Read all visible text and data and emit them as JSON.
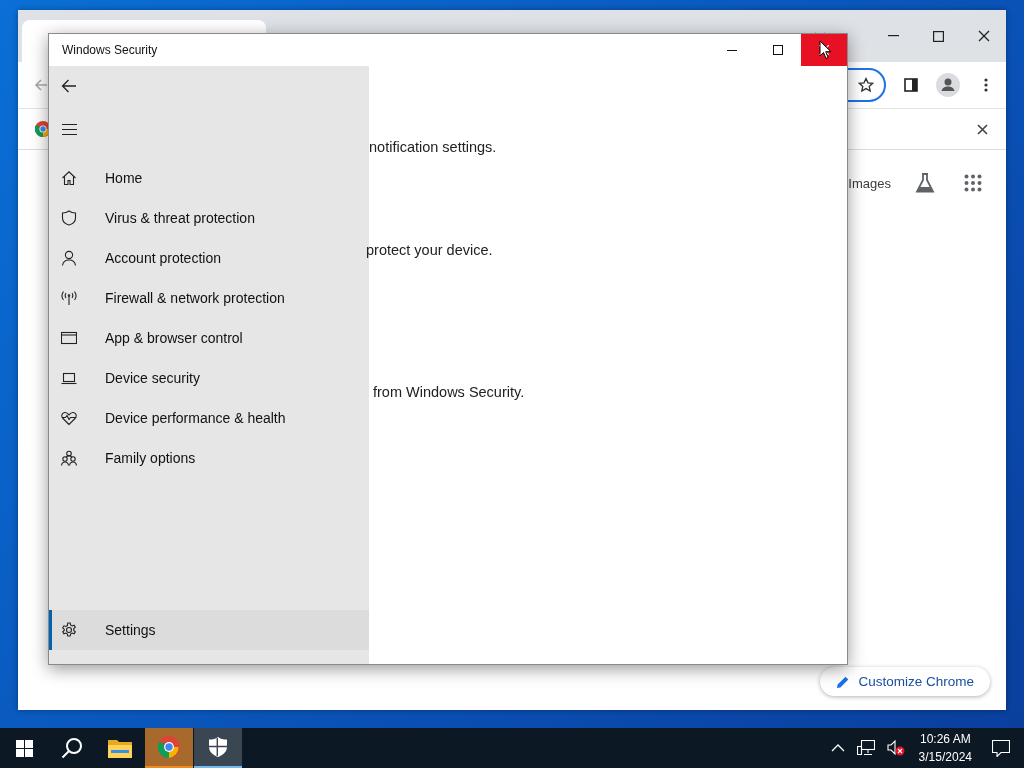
{
  "browser": {
    "toolbar": {
      "omnibox_focused": true
    },
    "results_header": {
      "images_link": "Images"
    },
    "customize_button": "Customize Chrome"
  },
  "security_window": {
    "title": "Windows Security",
    "nav": [
      {
        "label": "Home",
        "kind": "home",
        "selected": false
      },
      {
        "label": "Virus & threat protection",
        "kind": "shield",
        "selected": false
      },
      {
        "label": "Account protection",
        "kind": "person",
        "selected": false
      },
      {
        "label": "Firewall & network protection",
        "kind": "antenna",
        "selected": false
      },
      {
        "label": "App & browser control",
        "kind": "window",
        "selected": false
      },
      {
        "label": "Device security",
        "kind": "laptop",
        "selected": false
      },
      {
        "label": "Device performance & health",
        "kind": "heart",
        "selected": false
      },
      {
        "label": "Family options",
        "kind": "family",
        "selected": false
      }
    ],
    "settings": {
      "label": "Settings",
      "selected": true
    },
    "content_lines": [
      "notification settings.",
      "protect your device.",
      "from Windows Security."
    ]
  },
  "taskbar": {
    "apps": [
      {
        "kind": "start",
        "selected": false,
        "needs_attention": false
      },
      {
        "kind": "search",
        "selected": false,
        "needs_attention": false
      },
      {
        "kind": "explorer",
        "selected": false,
        "needs_attention": false
      },
      {
        "kind": "chrome",
        "selected": false,
        "needs_attention": true
      },
      {
        "kind": "security",
        "selected": true,
        "needs_attention": false
      }
    ],
    "time": "10:26 AM",
    "date": "3/15/2024"
  }
}
